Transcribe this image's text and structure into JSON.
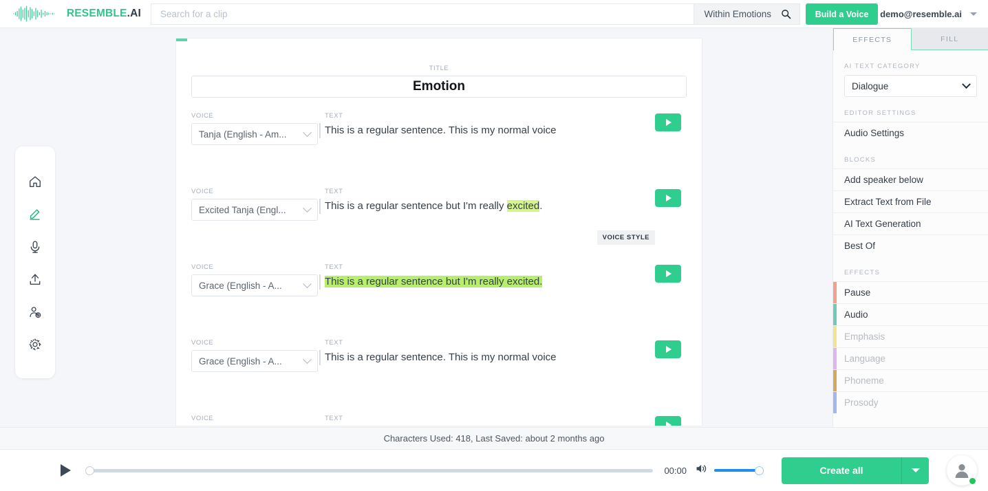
{
  "topbar": {
    "brand_primary": "RESEMBLE",
    "brand_suffix": ".AI",
    "search_placeholder": "Search for a clip",
    "search_value": "",
    "scope_label": "Within Emotions",
    "search_icon": "search-icon",
    "build_voice_label": "Build a Voice",
    "account_email": "demo@resemble.ai"
  },
  "sidebar": {
    "items": [
      {
        "icon": "home-icon",
        "name": "home",
        "active": false
      },
      {
        "icon": "pencil-icon",
        "name": "edit",
        "active": true
      },
      {
        "icon": "microphone-icon",
        "name": "record",
        "active": false
      },
      {
        "icon": "upload-icon",
        "name": "upload",
        "active": false
      },
      {
        "icon": "add-user-icon",
        "name": "team",
        "active": false
      },
      {
        "icon": "gear-icon",
        "name": "settings",
        "active": false
      }
    ]
  },
  "editor": {
    "title_label": "TITLE",
    "title_value": "Emotion",
    "voice_label": "VOICE",
    "text_label": "TEXT",
    "voice_style_tag": "VOICE STYLE",
    "rows": [
      {
        "voice": "Tanja (English - Am...",
        "text_plain": "This is a regular sentence. This is my normal voice",
        "highlight": "none"
      },
      {
        "voice": "Excited Tanja (Engl...",
        "text_prefix": "This is a regular sentence but I'm really ",
        "text_highlight": "excited",
        "text_suffix": ".",
        "highlight": "word"
      },
      {
        "voice": "Grace (English - A...",
        "text_plain": "This is a regular sentence but I'm really excited.",
        "highlight": "full"
      },
      {
        "voice": "Grace (English - A...",
        "text_plain": "This is a regular sentence. This is my normal voice",
        "highlight": "none"
      },
      {
        "voice": "",
        "text_plain": "",
        "highlight": "bar"
      }
    ]
  },
  "right_panel": {
    "tabs": [
      {
        "label": "EFFECTS",
        "active": true
      },
      {
        "label": "FILL",
        "active": false
      }
    ],
    "category_label": "AI TEXT CATEGORY",
    "category_value": "Dialogue",
    "editor_settings_label": "EDITOR SETTINGS",
    "editor_settings_items": [
      "Audio Settings"
    ],
    "blocks_label": "BLOCKS",
    "blocks_items": [
      "Add speaker below",
      "Extract Text from File",
      "AI Text Generation",
      "Best Of"
    ],
    "effects_label": "EFFECTS",
    "effects_items": [
      {
        "label": "Pause",
        "color": "#f2a08c",
        "enabled": true
      },
      {
        "label": "Audio",
        "color": "#6fcbb8",
        "enabled": true
      },
      {
        "label": "Emphasis",
        "color": "#f2e394",
        "enabled": false
      },
      {
        "label": "Language",
        "color": "#e0b4ee",
        "enabled": false
      },
      {
        "label": "Phoneme",
        "color": "#d4a95c",
        "enabled": false
      },
      {
        "label": "Prosody",
        "color": "#a4b6ee",
        "enabled": false
      }
    ]
  },
  "status": {
    "text": "Characters Used: 418, Last Saved: about 2 months ago"
  },
  "player": {
    "play_icon": "play-icon",
    "timecode": "00:00",
    "volume_icon": "volume-icon",
    "create_label": "Create all",
    "create_caret_icon": "chevron-down-icon",
    "avatar_icon": "user-avatar-icon",
    "progress_percent": 0,
    "volume_percent": 100
  },
  "colors": {
    "accent_green": "#2fcd8e",
    "highlight_green": "#d3f58c",
    "volume_blue": "#1f8ef1"
  }
}
